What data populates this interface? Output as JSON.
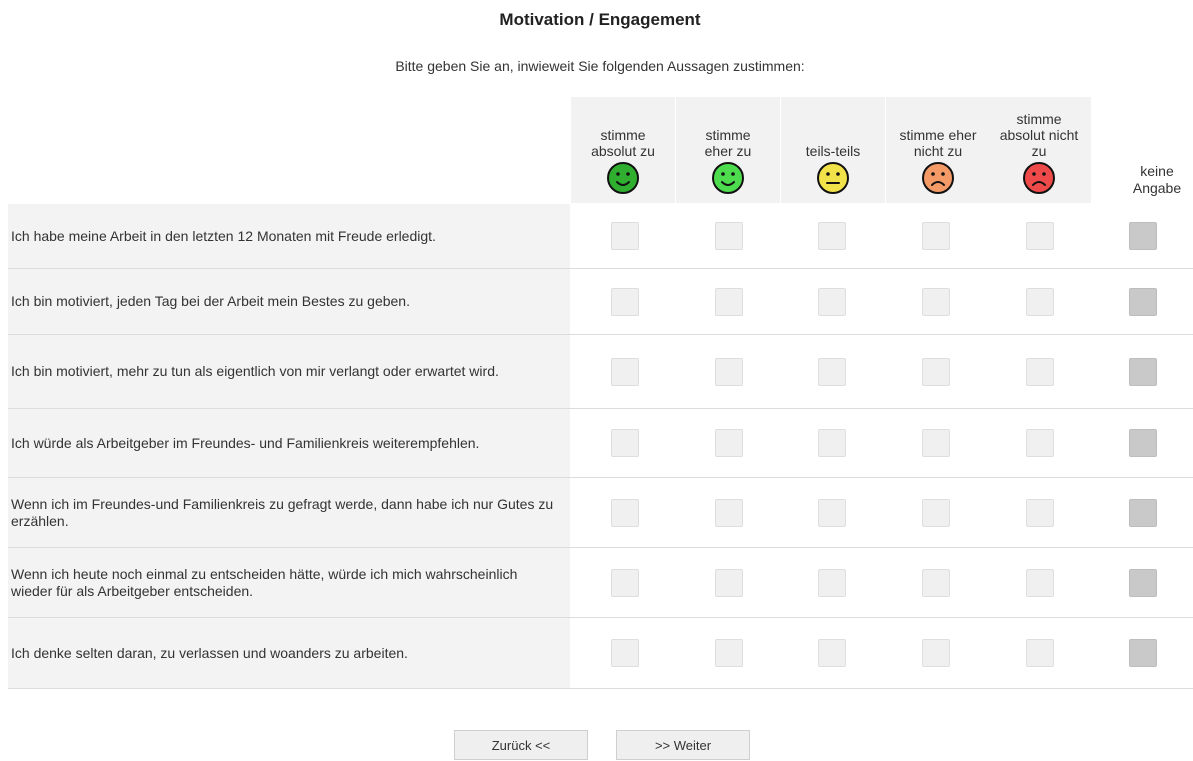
{
  "title": "Motivation / Engagement",
  "subtitle": "Bitte geben Sie an, inwieweit Sie folgenden Aussagen zustimmen:",
  "scale": [
    {
      "lines": [
        "stimme",
        "absolut zu"
      ],
      "color": "#2fae2f",
      "mood": "happy",
      "icon": "happy-face-icon"
    },
    {
      "lines": [
        "stimme",
        "eher zu"
      ],
      "color": "#4ddc4d",
      "mood": "happy",
      "icon": "happy-face-icon"
    },
    {
      "lines": [
        "teils-teils"
      ],
      "color": "#f2e24a",
      "mood": "neutral",
      "icon": "neutral-face-icon"
    },
    {
      "lines": [
        "stimme eher",
        "nicht zu"
      ],
      "color": "#f49a67",
      "mood": "sad",
      "icon": "sad-face-icon"
    },
    {
      "lines": [
        "stimme",
        "absolut nicht",
        "zu"
      ],
      "color": "#ef4a4a",
      "mood": "sad",
      "icon": "sad-face-icon"
    }
  ],
  "no_answer": {
    "lines": [
      "keine",
      "Angabe"
    ]
  },
  "questions": [
    {
      "text": "Ich habe meine Arbeit in den letzten 12 Monaten mit Freude erledigt."
    },
    {
      "text": "Ich bin motiviert, jeden Tag bei der Arbeit mein Bestes zu geben."
    },
    {
      "text": "Ich bin motiviert, mehr zu tun als eigentlich von mir verlangt oder erwartet wird."
    },
    {
      "text": "Ich würde als Arbeitgeber im Freundes- und Familienkreis weiterempfehlen."
    },
    {
      "text": "Wenn ich im Freundes-und Familienkreis zu gefragt werde, dann habe ich nur Gutes zu erzählen."
    },
    {
      "text": "Wenn ich heute noch einmal zu entscheiden hätte, würde ich mich wahrscheinlich wieder für als Arbeitgeber entscheiden."
    },
    {
      "text": "Ich denke selten daran, zu verlassen und woanders zu arbeiten."
    }
  ],
  "buttons": {
    "back": "Zurück <<",
    "next": ">> Weiter"
  }
}
